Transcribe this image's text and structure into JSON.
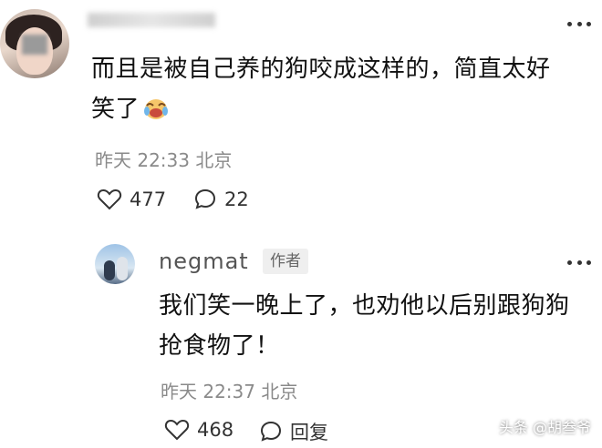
{
  "comment": {
    "text_line1": "而且是被自己养的狗咬成这样的，简直太好",
    "text_line2": "笑了",
    "emoji_icon": "laughing-crying-emoji",
    "meta": "昨天 22:33 北京",
    "likes": "477",
    "replies": "22"
  },
  "reply": {
    "username": "negmat",
    "badge": "作者",
    "text_line1": "我们笑一晚上了，也劝他以后别跟狗狗",
    "text_line2": "抢食物了！",
    "meta": "昨天 22:37 北京",
    "likes": "468",
    "reply_label": "回复"
  },
  "watermark": "头条 @胡叁爷"
}
